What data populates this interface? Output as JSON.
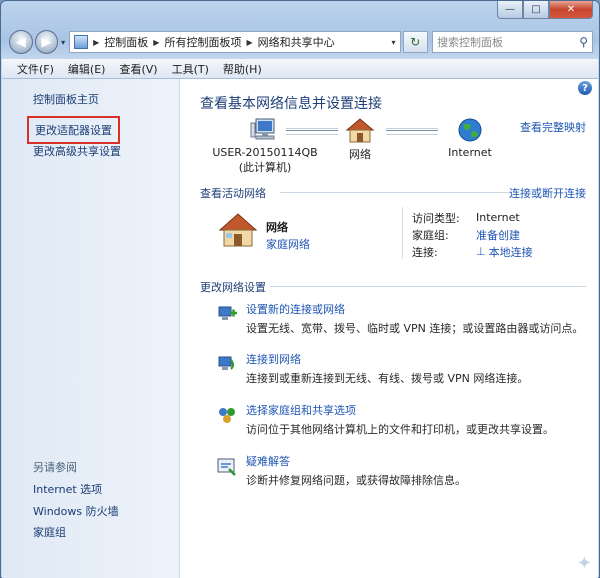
{
  "window": {
    "min": "—",
    "max": "□",
    "close": "✕"
  },
  "nav": {
    "back": "◀",
    "forward": "▶",
    "dropdown": "▾",
    "breadcrumbs": [
      "控制面板",
      "所有控制面板项",
      "网络和共享中心"
    ],
    "refresh": "↻",
    "search_placeholder": "搜索控制面板"
  },
  "menu": [
    "文件(F)",
    "编辑(E)",
    "查看(V)",
    "工具(T)",
    "帮助(H)"
  ],
  "sidebar": {
    "home": "控制面板主页",
    "adapter": "更改适配器设置",
    "advanced": "更改高级共享设置",
    "see_also": "另请参阅",
    "links": [
      "Internet 选项",
      "Windows 防火墙",
      "家庭组"
    ]
  },
  "main": {
    "help": "?",
    "title": "查看基本网络信息并设置连接",
    "full_map": "查看完整映射",
    "map": {
      "computer_line1": "USER-20150114QB",
      "computer_line2": "(此计算机)",
      "network": "网络",
      "internet": "Internet"
    },
    "active": {
      "heading": "查看活动网络",
      "connect_link": "连接或断开连接",
      "name": "网络",
      "type_link": "家庭网络",
      "access_label": "访问类型:",
      "access_value": "Internet",
      "homegroup_label": "家庭组:",
      "homegroup_value": "准备创建",
      "connection_label": "连接:",
      "connection_value": "本地连接"
    },
    "change": {
      "heading": "更改网络设置",
      "tasks": [
        {
          "title": "设置新的连接或网络",
          "desc": "设置无线、宽带、拨号、临时或 VPN 连接；或设置路由器或访问点。"
        },
        {
          "title": "连接到网络",
          "desc": "连接到或重新连接到无线、有线、拨号或 VPN 网络连接。"
        },
        {
          "title": "选择家庭组和共享选项",
          "desc": "访问位于其他网络计算机上的文件和打印机，或更改共享设置。"
        },
        {
          "title": "疑难解答",
          "desc": "诊断并修复网络问题，或获得故障排除信息。"
        }
      ]
    }
  }
}
